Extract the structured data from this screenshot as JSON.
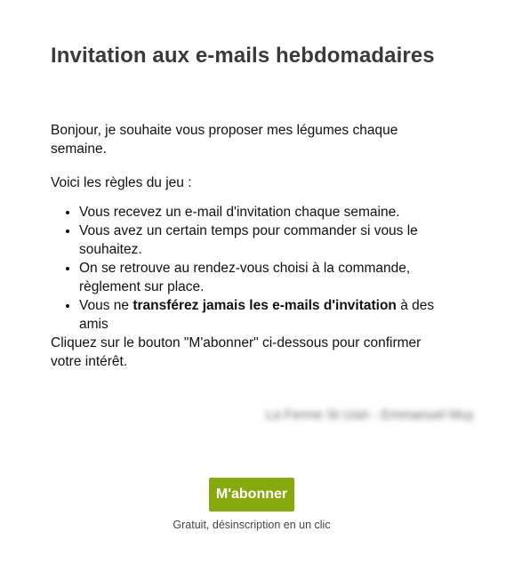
{
  "header": {
    "title": "Invitation aux e-mails hebdomadaires"
  },
  "body": {
    "intro": "Bonjour, je souhaite vous proposer mes légumes chaque semaine.",
    "rules_intro": "Voici les règles du jeu :",
    "rules": [
      "Vous recevez un e-mail d'invitation chaque semaine.",
      "Vous avez un certain temps pour commander si vous le souhaitez.",
      "On se retrouve au rendez-vous choisi à la commande, règlement sur place."
    ],
    "rule4": {
      "before": "Vous ne ",
      "bold": "transférez jamais les e-mails d'invitation",
      "after": " à des amis"
    },
    "cta_text": "Cliquez sur le bouton \"M'abonner\" ci-dessous pour confirmer votre intérêt."
  },
  "signature": {
    "text": "La Ferme St Usin - Emmanuel Muy"
  },
  "cta": {
    "button_label": "M'abonner",
    "button_color": "#86aa0e",
    "footnote": "Gratuit, désinscription en un clic"
  }
}
